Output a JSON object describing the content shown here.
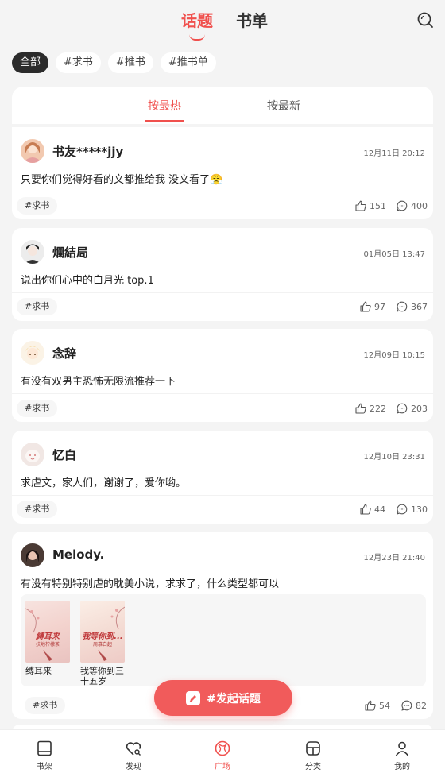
{
  "header": {
    "tabs": [
      {
        "label": "话题",
        "active": true
      },
      {
        "label": "书单",
        "active": false
      }
    ]
  },
  "chips": [
    {
      "label": "全部",
      "active": true
    },
    {
      "label": "#求书",
      "active": false
    },
    {
      "label": "#推书",
      "active": false
    },
    {
      "label": "#推书单",
      "active": false
    }
  ],
  "sort_tabs": [
    {
      "label": "按最热",
      "active": true
    },
    {
      "label": "按最新",
      "active": false
    }
  ],
  "posts": [
    {
      "username": "书友*****jjy",
      "time": "12月11日 20:12",
      "text": "只要你们觉得好看的文都推给我 没文看了😤",
      "tag": "#求书",
      "likes": "151",
      "comments": "400",
      "avatar_color": "#f2c9b0"
    },
    {
      "username": "爛結局",
      "time": "01月05日 13:47",
      "text": "说出你们心中的白月光 top.1",
      "tag": "#求书",
      "likes": "97",
      "comments": "367",
      "avatar_color": "#d9d9d9"
    },
    {
      "username": "念辞",
      "time": "12月09日 10:15",
      "text": "有没有双男主恐怖无限流推荐一下",
      "tag": "#求书",
      "likes": "222",
      "comments": "203",
      "avatar_color": "#f7dfb8"
    },
    {
      "username": "忆白",
      "time": "12月10日 23:31",
      "text": "求虐文，家人们，谢谢了，爱你哟。",
      "tag": "#求书",
      "likes": "44",
      "comments": "130",
      "avatar_color": "#f1e7e4"
    },
    {
      "username": "Melody.",
      "time": "12月23日 21:40",
      "text": "有没有特别特别虐的耽美小说，求求了，什么类型都可以",
      "tag": "#求书",
      "likes": "54",
      "comments": "82",
      "avatar_color": "#4a3a34",
      "books": [
        {
          "cover_title": "縛耳来",
          "cover_sub": "扶地柠檬茶",
          "name": "缚耳来"
        },
        {
          "cover_title": "我等你到...",
          "cover_sub": "周慕白起",
          "name": "我等你到三十五岁"
        }
      ]
    }
  ],
  "fab": {
    "label": "#发起话题"
  },
  "bottom_nav": [
    {
      "label": "书架",
      "icon": "bookshelf-icon",
      "active": false
    },
    {
      "label": "发现",
      "icon": "discover-icon",
      "active": false
    },
    {
      "label": "广场",
      "icon": "plaza-icon",
      "active": true
    },
    {
      "label": "分类",
      "icon": "category-icon",
      "active": false
    },
    {
      "label": "我的",
      "icon": "profile-icon",
      "active": false
    }
  ],
  "colors": {
    "accent": "#f0504d",
    "fab": "#f15b5b",
    "background": "#f4f4f4"
  }
}
